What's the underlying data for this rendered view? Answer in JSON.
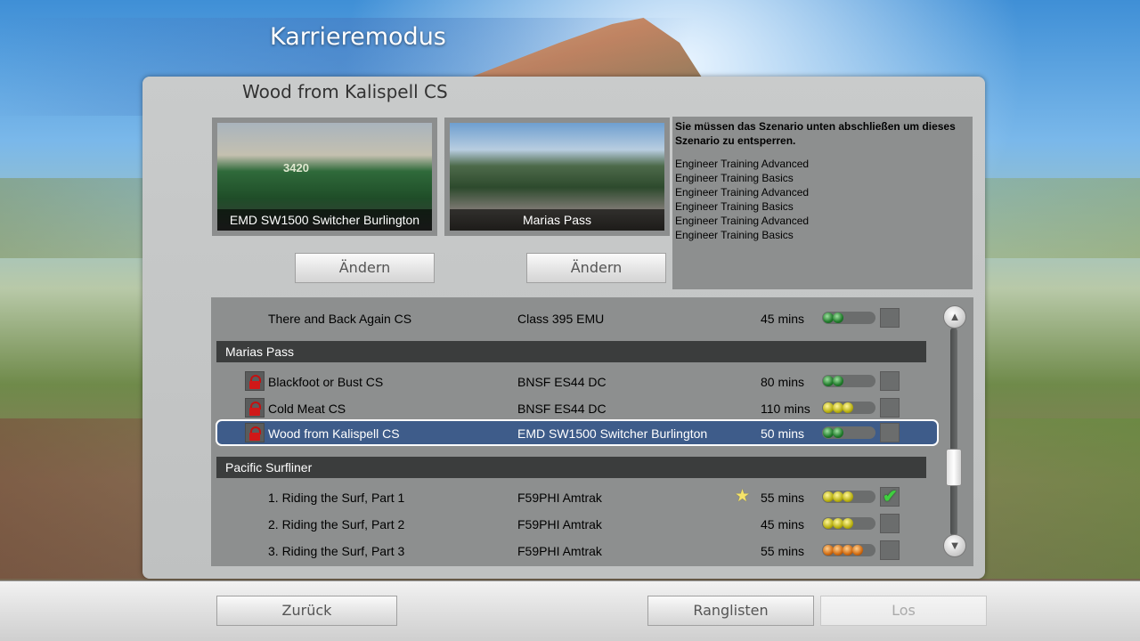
{
  "screen": {
    "title": "Karrieremodus"
  },
  "scenario": {
    "heading": "Wood from Kalispell CS",
    "locomotive_caption": "EMD SW1500 Switcher Burlington",
    "locomotive_number": "3420",
    "route_caption": "Marias Pass",
    "change_loco_label": "Ändern",
    "change_route_label": "Ändern"
  },
  "info": {
    "message": "Sie müssen das Szenario unten abschließen um dieses Szenario zu entsperren.",
    "requirements": [
      "Engineer Training Advanced",
      "Engineer Training Basics",
      "Engineer Training Advanced",
      "Engineer Training Basics",
      "Engineer Training Advanced",
      "Engineer Training Basics"
    ]
  },
  "list": {
    "rows": [
      {
        "name": "There and Back Again CS",
        "loco": "Class 395 EMU",
        "duration": "45 mins",
        "difficulty": 2,
        "difficulty_color": "green",
        "locked": false,
        "completed": false,
        "starred": false
      },
      {
        "group": "Marias Pass"
      },
      {
        "name": "Blackfoot or Bust CS",
        "loco": "BNSF ES44 DC",
        "duration": "80 mins",
        "difficulty": 2,
        "difficulty_color": "green",
        "locked": true,
        "completed": false,
        "starred": false
      },
      {
        "name": "Cold Meat CS",
        "loco": "BNSF ES44 DC",
        "duration": "110 mins",
        "difficulty": 3,
        "difficulty_color": "yellow",
        "locked": true,
        "completed": false,
        "starred": false
      },
      {
        "name": "Wood from Kalispell CS",
        "loco": "EMD SW1500 Switcher Burlington",
        "duration": "50 mins",
        "difficulty": 2,
        "difficulty_color": "green",
        "locked": true,
        "completed": false,
        "starred": false,
        "selected": true
      },
      {
        "group": "Pacific Surfliner"
      },
      {
        "name": "1. Riding the Surf, Part 1",
        "loco": "F59PHI Amtrak",
        "duration": "55 mins",
        "difficulty": 3,
        "difficulty_color": "yellow",
        "locked": false,
        "completed": true,
        "starred": true
      },
      {
        "name": "2. Riding the Surf, Part 2",
        "loco": "F59PHI Amtrak",
        "duration": "45 mins",
        "difficulty": 3,
        "difficulty_color": "yellow",
        "locked": false,
        "completed": false,
        "starred": false
      },
      {
        "name": "3. Riding the Surf, Part 3",
        "loco": "F59PHI Amtrak",
        "duration": "55 mins",
        "difficulty": 4,
        "difficulty_color": "orange",
        "locked": false,
        "completed": false,
        "starred": false
      }
    ],
    "scroll_position": 0.72
  },
  "footer": {
    "back_label": "Zurück",
    "leaderboard_label": "Ranglisten",
    "go_label": "Los"
  },
  "icons": {
    "lock": "lock-icon",
    "check": "checkmark-icon",
    "star": "star-icon",
    "scroll_up": "chevron-up-icon",
    "scroll_down": "chevron-down-icon"
  }
}
